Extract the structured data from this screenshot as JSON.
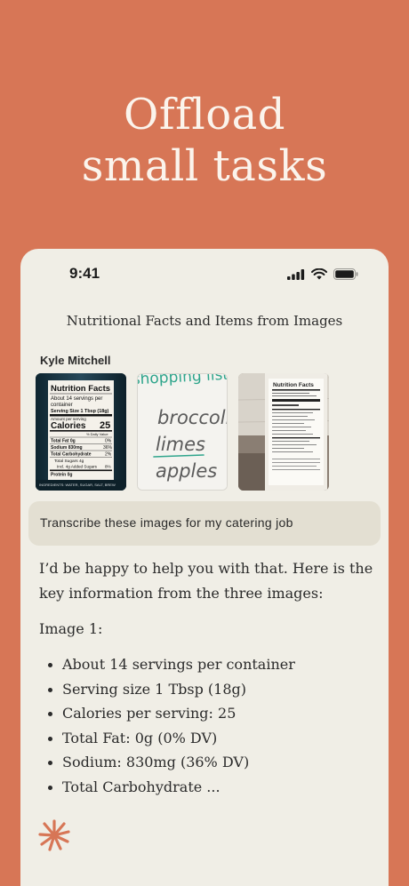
{
  "headline": {
    "line1": "Offload",
    "line2": "small tasks"
  },
  "status_bar": {
    "time": "9:41",
    "icons": [
      "signal-icon",
      "wifi-icon",
      "battery-icon"
    ]
  },
  "chat": {
    "title": "Nutritional Facts and Items from Images",
    "sender": "Kyle Mitchell",
    "images": [
      {
        "name": "nutrition-label-photo",
        "header": "Nutrition Facts",
        "servings": "About 14 servings per",
        "container": "container",
        "serving_size": "Serving Size 1 Tbsp (18g)",
        "amount": "Amount per serving",
        "calories_label": "Calories",
        "calories_value": "25",
        "dv": "% Daily Value",
        "fat": "Total Fat 0g",
        "fat_pct": "0%",
        "sodium": "Sodium 830mg",
        "sodium_pct": "36%",
        "carb": "Total Carbohydrate",
        "carb_pct": "2%",
        "sugars": "Total Sugars 4g",
        "added": "Incl. 4g Added Sugars",
        "added_pct": "8%",
        "protein": "Protein 0g",
        "ingredients": "INGREDIENTS: WATER, SUGAR, SALT, BREW"
      },
      {
        "name": "shopping-list-photo",
        "heading": "shopping list",
        "items": [
          "broccoli",
          "limes",
          "apples"
        ]
      },
      {
        "name": "product-label-photo",
        "header": "Nutrition Facts"
      }
    ],
    "prompt": "Transcribe these images for my catering job",
    "answer": {
      "intro": "I’d be happy to help you with that. Here is the key information from the three images:",
      "heading": "Image 1:",
      "bullets": [
        "About 14 servings per container",
        "Serving size 1 Tbsp (18g)",
        "Calories per serving: 25",
        "Total Fat: 0g (0% DV)",
        "Sodium: 830mg (36% DV)",
        "Total Carbohydrate ..."
      ]
    }
  },
  "colors": {
    "background": "#d77656",
    "card": "#f0eee6",
    "prompt_bubble": "#e3dfd2",
    "spark": "#d77656",
    "headline_text": "#fbf4ec"
  }
}
